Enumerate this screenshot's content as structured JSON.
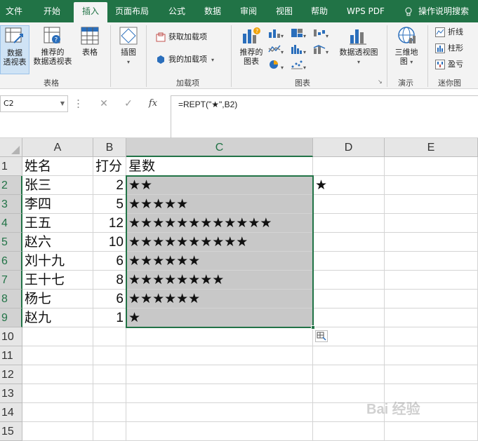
{
  "tabs": [
    "文件",
    "开始",
    "插入",
    "页面布局",
    "公式",
    "数据",
    "审阅",
    "视图",
    "帮助",
    "WPS PDF"
  ],
  "active_tab": "插入",
  "tell_me": "操作说明搜索",
  "ribbon": {
    "groups": {
      "tables": {
        "label": "表格",
        "pivot_table": "数据\n透视表",
        "recommended_pivot": "推荐的\n数据透视表",
        "table": "表格"
      },
      "illustrations": {
        "insert_picture": "插图"
      },
      "addins": {
        "label": "加载项",
        "get_addins": "获取加载项",
        "my_addins": "我的加载项"
      },
      "charts": {
        "label": "图表",
        "recommended_charts": "推荐的\n图表",
        "pivot_chart": "数据透视图"
      },
      "tours": {
        "label": "演示",
        "map_3d": "三维地\n图"
      },
      "sparklines": {
        "label": "迷你图",
        "line": "折线",
        "column": "柱形",
        "win_loss": "盈亏"
      }
    }
  },
  "formula_bar": {
    "name_box": "C2",
    "formula": "=REPT(\"★\",B2)"
  },
  "columns": [
    "A",
    "B",
    "C",
    "D",
    "E"
  ],
  "rows": [
    "1",
    "2",
    "3",
    "4",
    "5",
    "6",
    "7",
    "8",
    "9",
    "10",
    "11",
    "12",
    "13",
    "14",
    "15"
  ],
  "sheet": {
    "headers": {
      "name": "姓名",
      "score": "打分",
      "stars": "星数"
    },
    "data": [
      {
        "name": "张三",
        "score": "2",
        "stars": "★★"
      },
      {
        "name": "李四",
        "score": "5",
        "stars": "★★★★★"
      },
      {
        "name": "王五",
        "score": "12",
        "stars": "★★★★★★★★★★★★"
      },
      {
        "name": "赵六",
        "score": "10",
        "stars": "★★★★★★★★★★"
      },
      {
        "name": "刘十九",
        "score": "6",
        "stars": "★★★★★★"
      },
      {
        "name": "王十七",
        "score": "8",
        "stars": "★★★★★★★★"
      },
      {
        "name": "杨七",
        "score": "6",
        "stars": "★★★★★★"
      },
      {
        "name": "赵九",
        "score": "1",
        "stars": "★"
      }
    ],
    "d2": "★"
  },
  "selection": "C2:C9",
  "colors": {
    "accent": "#217346",
    "selection_fill": "#c8c8c8"
  },
  "watermark": "Bai 经验"
}
